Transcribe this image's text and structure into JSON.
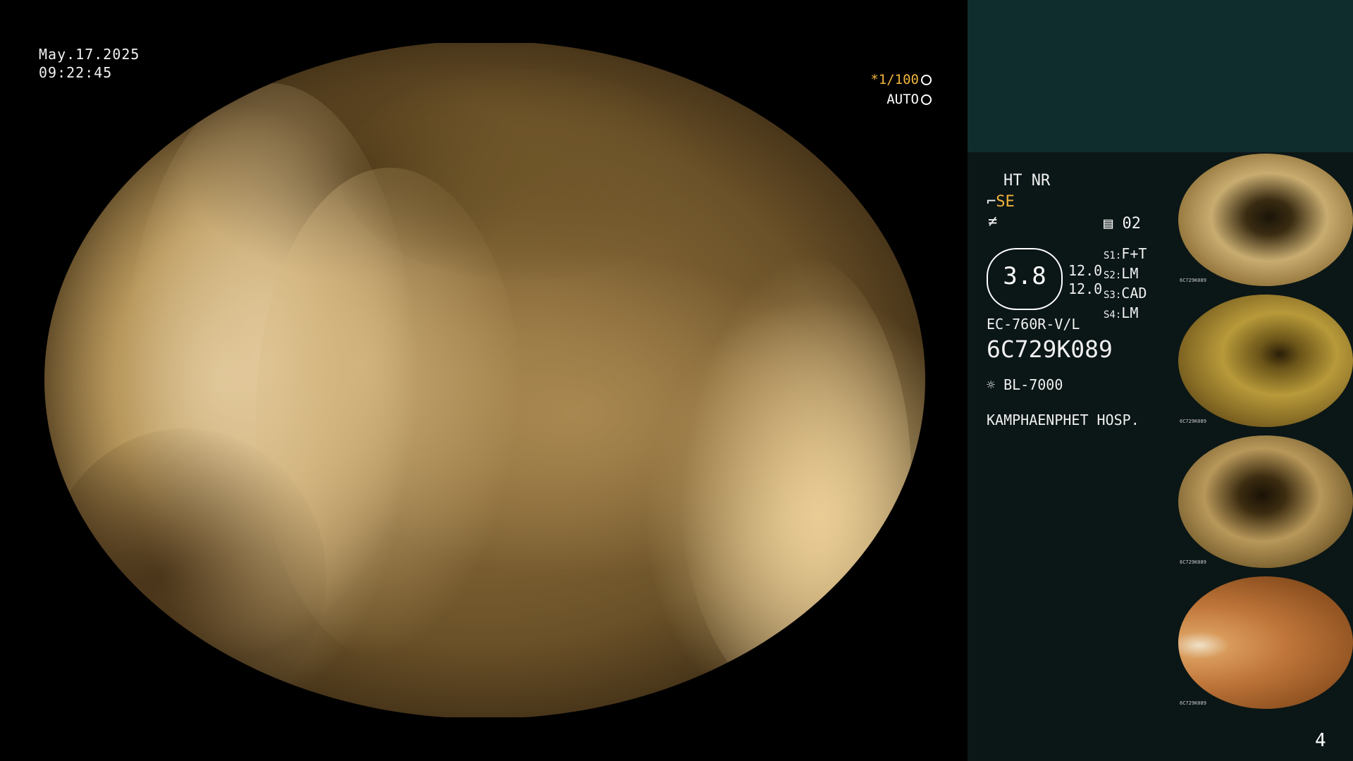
{
  "overlay": {
    "date": "May.17.2025",
    "time": "09:22:45",
    "shutter": "*1/100",
    "exposure_mode": "AUTO"
  },
  "settings": {
    "ht_nr": "HT NR",
    "enhancement": "SE",
    "memory": "02",
    "zoom_value": "3.8",
    "value_a": "12.0",
    "value_b": "12.0",
    "s1_label": "S1:",
    "s1_value": "F+T",
    "s2_label": "S2:",
    "s2_value": "LM",
    "s3_label": "S3:",
    "s3_value": "CAD",
    "s4_label": "S4:",
    "s4_value": "LM"
  },
  "device": {
    "scope_model": "EC-760R-V/L",
    "serial": "6C729K089",
    "light_source": "BL-7000",
    "hospital": "KAMPHAENPHET HOSP."
  },
  "thumbnails": [
    {
      "tag": "6C729K089"
    },
    {
      "tag": "6C729K089"
    },
    {
      "tag": "6C729K089"
    },
    {
      "tag": "6C729K089"
    }
  ],
  "page_number": "4",
  "colors": {
    "accent": "#f0b43c",
    "panel_top": "#0f2d2d",
    "panel": "#0b1616"
  },
  "icons": [
    "shutter-icon",
    "auto-exposure-icon",
    "enhancement-icon",
    "filter-icon",
    "memory-icon",
    "light-source-icon"
  ]
}
